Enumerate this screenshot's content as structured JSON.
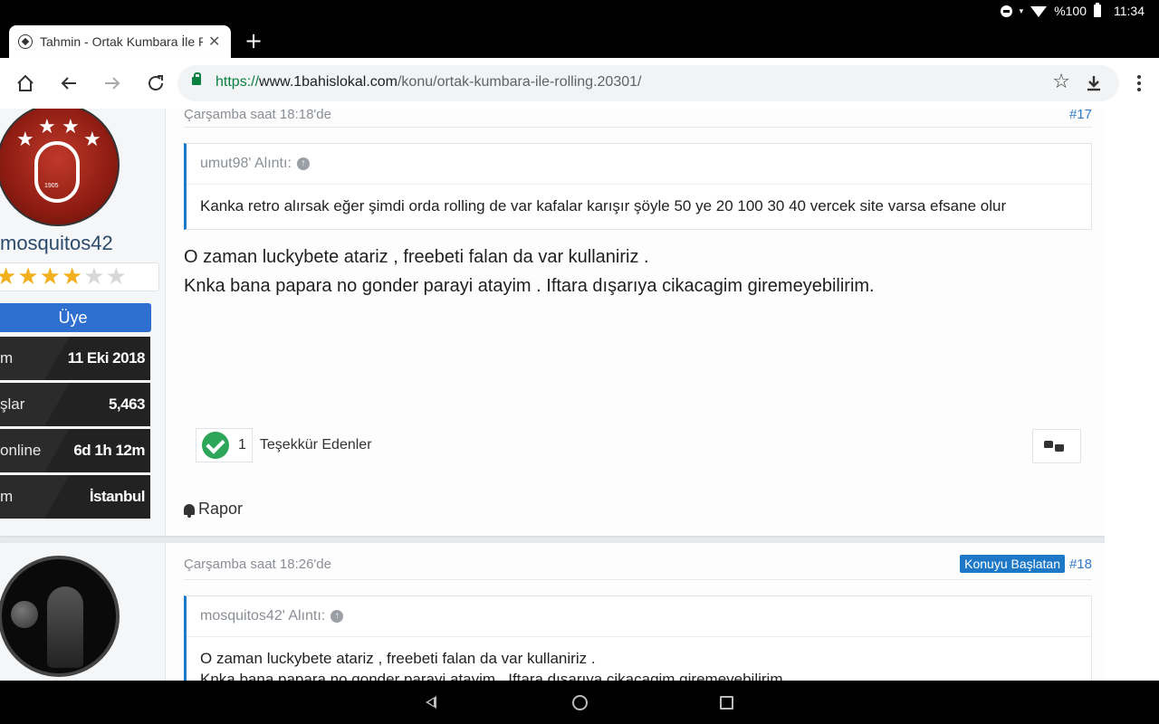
{
  "status_bar": {
    "battery": "%100",
    "time": "11:34"
  },
  "tab": {
    "title": "Tahmin - Ortak Kumbara İle R",
    "close": "✕",
    "new_tab": "+"
  },
  "toolbar": {
    "url_scheme": "https://",
    "url_host": "www.1bahislokal.com",
    "url_path": "/konu/ortak-kumbara-ile-rolling.20301/"
  },
  "posts": [
    {
      "username": "mosquitos42",
      "rating": 3,
      "rank": "Üye",
      "stats": [
        {
          "key": "m",
          "value": "11 Eki 2018"
        },
        {
          "key": "şlar",
          "value": "5,463"
        },
        {
          "key": "online",
          "value": "6d 1h 12m"
        },
        {
          "key": "m",
          "value": "İstanbul"
        }
      ],
      "date": "Çarşamba saat 18:18'de",
      "number": "#17",
      "quote_author": "umut98' Alıntı:",
      "quote_text": "Kanka retro alırsak eğer şimdi orda rolling de var kafalar karışır şöyle 50 ye 20 100 30 40 vercek site varsa efsane olur",
      "body_line1": "O zaman luckybete atariz , freebeti falan da var kullaniriz .",
      "body_line2": "Knka bana papara no gonder parayi atayim . Iftara dışarıya cikacagim giremeyebilirim.",
      "thanks_count": "1",
      "thanks_label": "Teşekkür Edenler",
      "report_label": "Rapor"
    },
    {
      "date": "Çarşamba saat 18:26'de",
      "op_badge": "Konuyu Başlatan",
      "number": "#18",
      "quote_author": "mosquitos42' Alıntı:",
      "quote_line1": "O zaman luckybete atariz , freebeti falan da var kullaniriz .",
      "quote_line2": "Knka bana papara no gonder parayi atayim . Iftara dışarıya cikacagim giremeyebilirim."
    }
  ],
  "avatar_year": "1905"
}
